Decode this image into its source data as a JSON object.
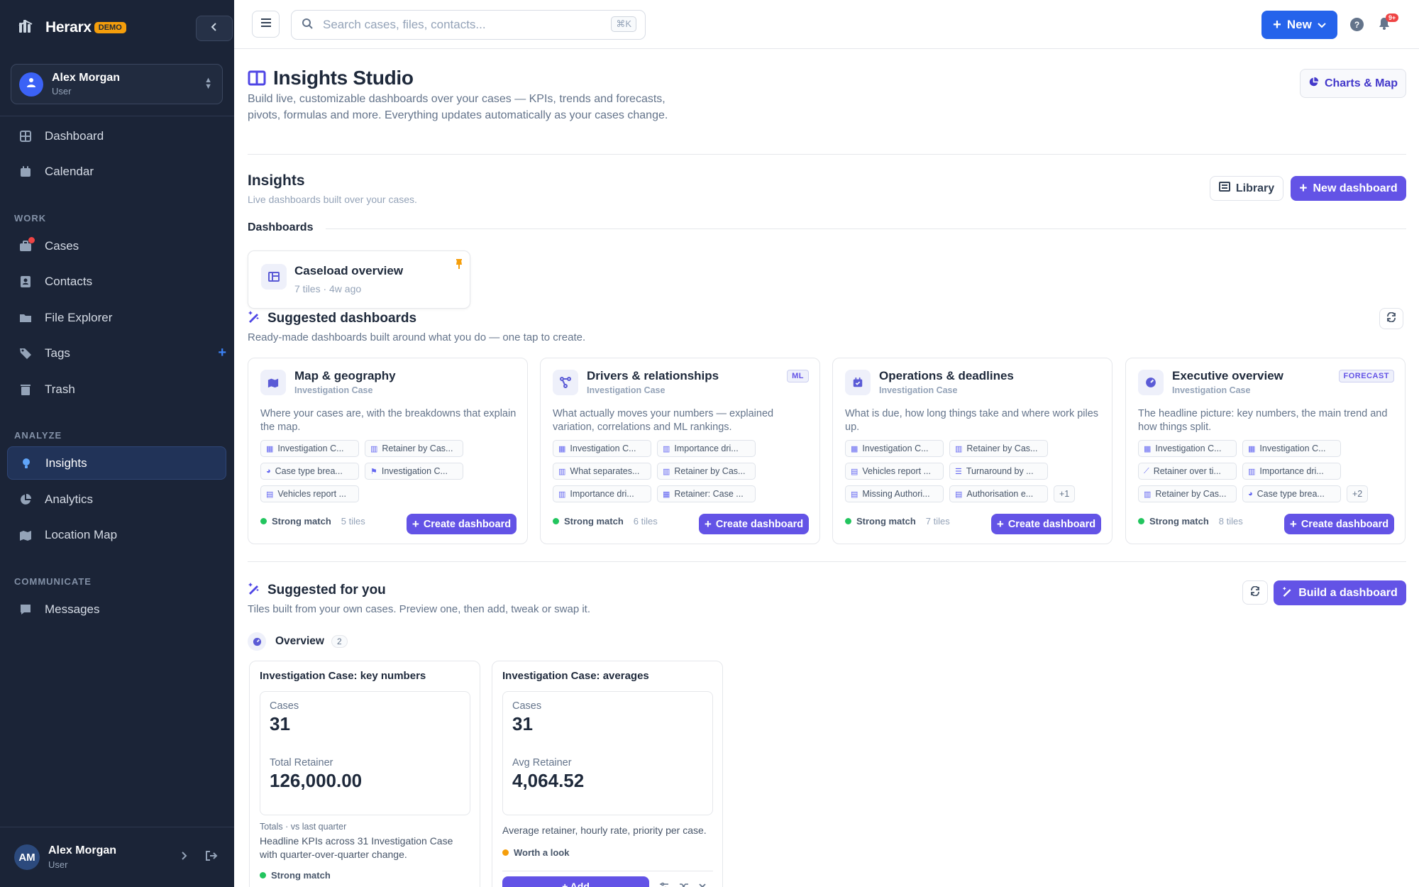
{
  "sidebar": {
    "brand": "Herarx",
    "demo_badge": "DEMO",
    "user": {
      "name": "Alex Morgan",
      "role": "User"
    },
    "nav_top": [
      {
        "label": "Dashboard",
        "icon": "grid-icon"
      },
      {
        "label": "Calendar",
        "icon": "calendar-icon"
      }
    ],
    "section_work": "WORK",
    "nav_work": [
      {
        "label": "Cases",
        "icon": "briefcase-icon"
      },
      {
        "label": "Contacts",
        "icon": "contacts-icon"
      },
      {
        "label": "File Explorer",
        "icon": "folder-icon"
      },
      {
        "label": "Tags",
        "icon": "tag-icon"
      },
      {
        "label": "Trash",
        "icon": "trash-icon"
      }
    ],
    "section_analyze": "ANALYZE",
    "nav_analyze": [
      {
        "label": "Insights",
        "icon": "lightbulb-icon",
        "active": true
      },
      {
        "label": "Analytics",
        "icon": "pie-chart-icon"
      },
      {
        "label": "Location Map",
        "icon": "map-icon"
      }
    ],
    "section_communicate": "COMMUNICATE",
    "nav_communicate": [
      {
        "label": "Messages",
        "icon": "message-icon"
      }
    ],
    "footer_user": {
      "initials": "AM",
      "name": "Alex Morgan",
      "role": "User"
    }
  },
  "topbar": {
    "search_placeholder": "Search cases, files, contacts...",
    "search_shortcut": "⌘K",
    "new_label": "New",
    "notification_count": "9+"
  },
  "page": {
    "title": "Insights Studio",
    "description": "Build live, customizable dashboards over your cases — KPIs, trends and forecasts, pivots, formulas and more. Everything updates automatically as your cases change.",
    "charts_map_label": "Charts & Map"
  },
  "insights": {
    "title": "Insights",
    "subtitle": "Live dashboards built over your cases.",
    "library_label": "Library",
    "new_dashboard_label": "New dashboard",
    "dashboards_label": "Dashboards",
    "dashboard": {
      "title": "Caseload overview",
      "meta": "7 tiles · 4w ago"
    }
  },
  "suggested_dashboards": {
    "title": "Suggested dashboards",
    "subtitle": "Ready-made dashboards built around what you do — one tap to create.",
    "create_label": "Create dashboard",
    "cards": [
      {
        "title": "Map & geography",
        "subtitle": "Investigation Case",
        "tag": "",
        "desc": "Where your cases are, with the breakdowns that explain the map.",
        "chips": [
          "Investigation C...",
          "Retainer by Cas...",
          "Case type brea...",
          "Investigation C...",
          "Vehicles report ..."
        ],
        "chip_icons": [
          "▦",
          "▥",
          "◕",
          "⚑",
          "▤"
        ],
        "more": "",
        "match": "Strong match",
        "tiles": "5 tiles"
      },
      {
        "title": "Drivers & relationships",
        "subtitle": "Investigation Case",
        "tag": "ML",
        "desc": "What actually moves your numbers — explained variation, correlations and ML rankings.",
        "chips": [
          "Investigation C...",
          "Importance dri...",
          "What separates...",
          "Retainer by Cas...",
          "Importance dri...",
          "Retainer: Case ..."
        ],
        "chip_icons": [
          "▦",
          "▥",
          "▥",
          "▥",
          "▥",
          "▦"
        ],
        "more": "",
        "match": "Strong match",
        "tiles": "6 tiles"
      },
      {
        "title": "Operations & deadlines",
        "subtitle": "Investigation Case",
        "tag": "",
        "desc": "What is due, how long things take and where work piles up.",
        "chips": [
          "Investigation C...",
          "Retainer by Cas...",
          "Vehicles report ...",
          "Turnaround by ...",
          "Missing Authori...",
          "Authorisation e..."
        ],
        "chip_icons": [
          "▦",
          "▥",
          "▤",
          "☰",
          "▤",
          "▤"
        ],
        "more": "+1",
        "match": "Strong match",
        "tiles": "7 tiles"
      },
      {
        "title": "Executive overview",
        "subtitle": "Investigation Case",
        "tag": "FORECAST",
        "desc": "The headline picture: key numbers, the main trend and how things split.",
        "chips": [
          "Investigation C...",
          "Investigation C...",
          "Retainer over ti...",
          "Importance dri...",
          "Retainer by Cas...",
          "Case type brea..."
        ],
        "chip_icons": [
          "▦",
          "▦",
          "⟋",
          "▥",
          "▥",
          "◕"
        ],
        "more": "+2",
        "match": "Strong match",
        "tiles": "8 tiles"
      }
    ]
  },
  "suggested_for_you": {
    "title": "Suggested for you",
    "subtitle": "Tiles built from your own cases. Preview one, then add, tweak or swap it.",
    "build_label": "Build a dashboard",
    "tab": {
      "label": "Overview",
      "count": "2"
    },
    "tiles": [
      {
        "title": "Investigation Case: key numbers",
        "k1_label": "Cases",
        "k1_value": "31",
        "k2_label": "Total Retainer",
        "k2_value": "126,000.00",
        "note": "Totals · vs last quarter",
        "desc": "Headline KPIs across 31 Investigation Case with quarter-over-quarter change.",
        "match": "Strong match",
        "match_color": "#22c55e"
      },
      {
        "title": "Investigation Case: averages",
        "k1_label": "Cases",
        "k1_value": "31",
        "k2_label": "Avg Retainer",
        "k2_value": "4,064.52",
        "note": "",
        "desc": "Average retainer, hourly rate, priority per case.",
        "match": "Worth a look",
        "match_color": "#f59e0b",
        "add_label": "+ Add"
      }
    ]
  },
  "colors": {
    "accent": "#6353e6",
    "primary": "#2563eb",
    "sidebar": "#1b2437"
  }
}
